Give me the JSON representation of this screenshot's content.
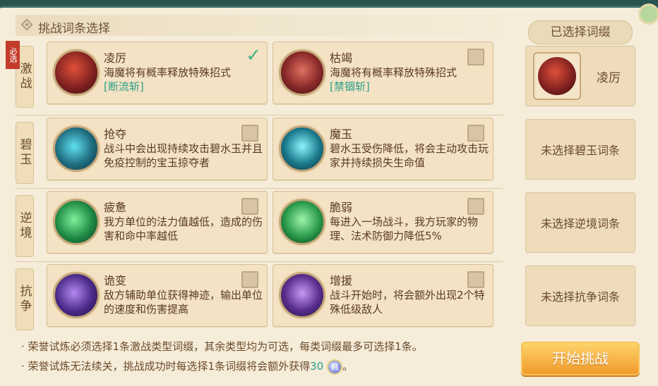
{
  "header": {
    "title": "挑战词条选择"
  },
  "right": {
    "title": "已选择词缀",
    "start_button": "开始挑战"
  },
  "rows": [
    {
      "category": "激战",
      "required_label": "必选",
      "cards": [
        {
          "title": "凌厉",
          "desc": "海魔将有概率释放特殊招式",
          "tag": "[断流斩]",
          "checked": true,
          "color": "#8a2a2a"
        },
        {
          "title": "枯竭",
          "desc": "海魔将有概率释放特殊招式",
          "tag": "[禁锢斩]",
          "checked": false,
          "color": "#7a2424"
        }
      ],
      "slot": {
        "text": "凌厉",
        "selected": true
      }
    },
    {
      "category": "碧玉",
      "cards": [
        {
          "title": "抢夺",
          "desc": "战斗中会出现持续攻击碧水玉并且免疫控制的宝玉掠夺者",
          "tag": "",
          "checked": false,
          "color": "#1f6e80"
        },
        {
          "title": "魔玉",
          "desc": "碧水玉受伤降低，将会主动攻击玩家并持续损失生命值",
          "tag": "",
          "checked": false,
          "color": "#1a7a8c"
        }
      ],
      "slot": {
        "text": "未选择碧玉词条",
        "selected": false
      }
    },
    {
      "category": "逆境",
      "cards": [
        {
          "title": "疲惫",
          "desc": "我方单位的法力值越低，造成的伤害和命中率越低",
          "tag": "",
          "checked": false,
          "color": "#1f8a44"
        },
        {
          "title": "脆弱",
          "desc": "每进入一场战斗，我方玩家的物理、法术防御力降低5%",
          "tag": "",
          "checked": false,
          "color": "#2a9a4a"
        }
      ],
      "slot": {
        "text": "未选择逆境词条",
        "selected": false
      }
    },
    {
      "category": "抗争",
      "cards": [
        {
          "title": "诡变",
          "desc": "敌方辅助单位获得神迹，输出单位的速度和伤害提高",
          "tag": "",
          "checked": false,
          "color": "#4a2a8a"
        },
        {
          "title": "增援",
          "desc": "战斗开始时，将会额外出现2个特殊低级敌人",
          "tag": "",
          "checked": false,
          "color": "#5a2e8e"
        }
      ],
      "slot": {
        "text": "未选择抗争词条",
        "selected": false
      }
    }
  ],
  "notes": {
    "line1": "· 荣誉试炼必须选择1条激战类型词缀，其余类型均为可选，每类词缀最多可选择1条。",
    "line2_pre": "· 荣誉试炼无法续关，挑战成功时每选择1条词缀将会额外获得",
    "line2_num": "30",
    "coin_label": "挑",
    "line2_post": "。"
  }
}
